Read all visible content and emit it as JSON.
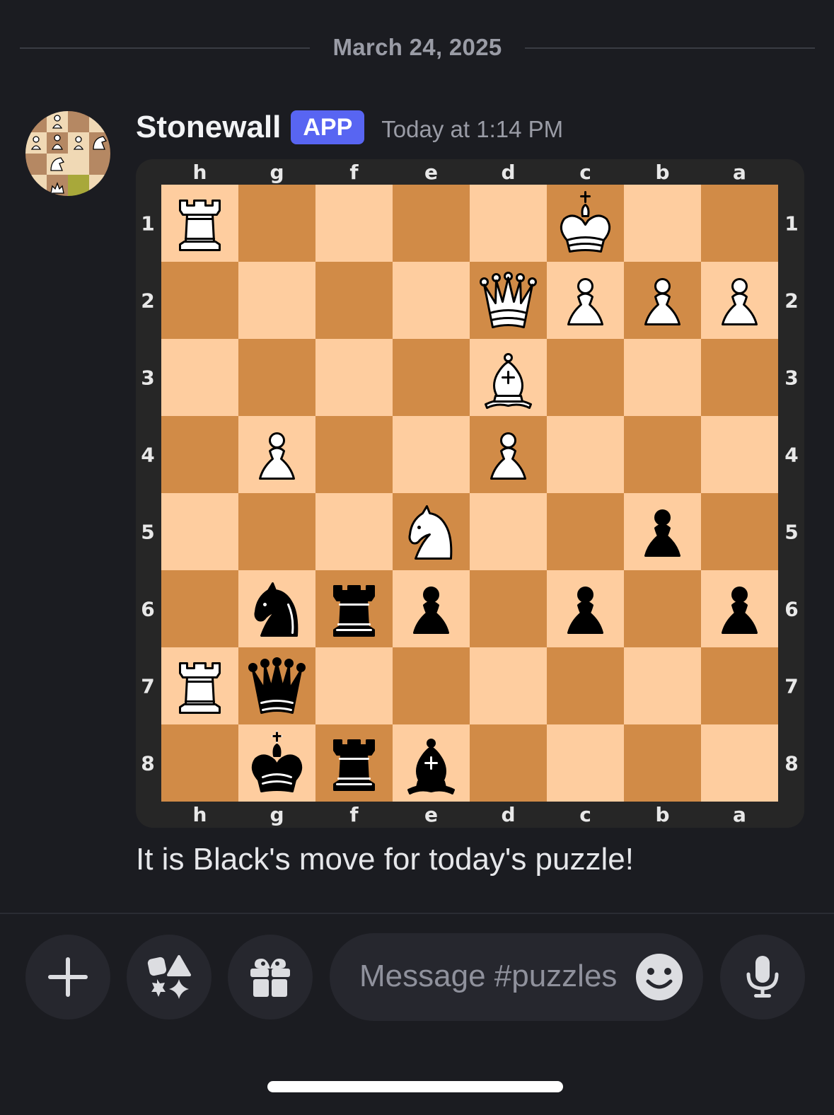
{
  "date_divider": {
    "text": "March 24, 2025"
  },
  "message": {
    "author": "Stonewall",
    "badge": "APP",
    "timestamp": "Today at 1:14 PM",
    "text": "It is Black's move for today's puzzle!"
  },
  "board": {
    "files_top": [
      "h",
      "g",
      "f",
      "e",
      "d",
      "c",
      "b",
      "a"
    ],
    "files_bottom": [
      "h",
      "g",
      "f",
      "e",
      "d",
      "c",
      "b",
      "a"
    ],
    "ranks": [
      "1",
      "2",
      "3",
      "4",
      "5",
      "6",
      "7",
      "8"
    ],
    "colors": {
      "light": "#fecd9f",
      "dark": "#d18b47",
      "frame": "#262626"
    },
    "pieces": [
      {
        "square": "h1",
        "piece": "white-rook"
      },
      {
        "square": "c1",
        "piece": "white-king"
      },
      {
        "square": "d2",
        "piece": "white-queen"
      },
      {
        "square": "c2",
        "piece": "white-pawn"
      },
      {
        "square": "b2",
        "piece": "white-pawn"
      },
      {
        "square": "a2",
        "piece": "white-pawn"
      },
      {
        "square": "d3",
        "piece": "white-bishop"
      },
      {
        "square": "g4",
        "piece": "white-pawn"
      },
      {
        "square": "d4",
        "piece": "white-pawn"
      },
      {
        "square": "e5",
        "piece": "white-knight"
      },
      {
        "square": "b5",
        "piece": "black-pawn"
      },
      {
        "square": "g6",
        "piece": "black-knight"
      },
      {
        "square": "f6",
        "piece": "black-rook"
      },
      {
        "square": "e6",
        "piece": "black-pawn"
      },
      {
        "square": "c6",
        "piece": "black-pawn"
      },
      {
        "square": "a6",
        "piece": "black-pawn"
      },
      {
        "square": "h7",
        "piece": "white-rook"
      },
      {
        "square": "g7",
        "piece": "black-queen"
      },
      {
        "square": "g8",
        "piece": "black-king"
      },
      {
        "square": "f8",
        "piece": "black-rook"
      },
      {
        "square": "e8",
        "piece": "black-bishop"
      }
    ]
  },
  "composer": {
    "placeholder": "Message #puzzles",
    "buttons": [
      "plus-icon",
      "apps-icon",
      "gift-icon",
      "emoji-icon",
      "microphone-icon"
    ]
  }
}
